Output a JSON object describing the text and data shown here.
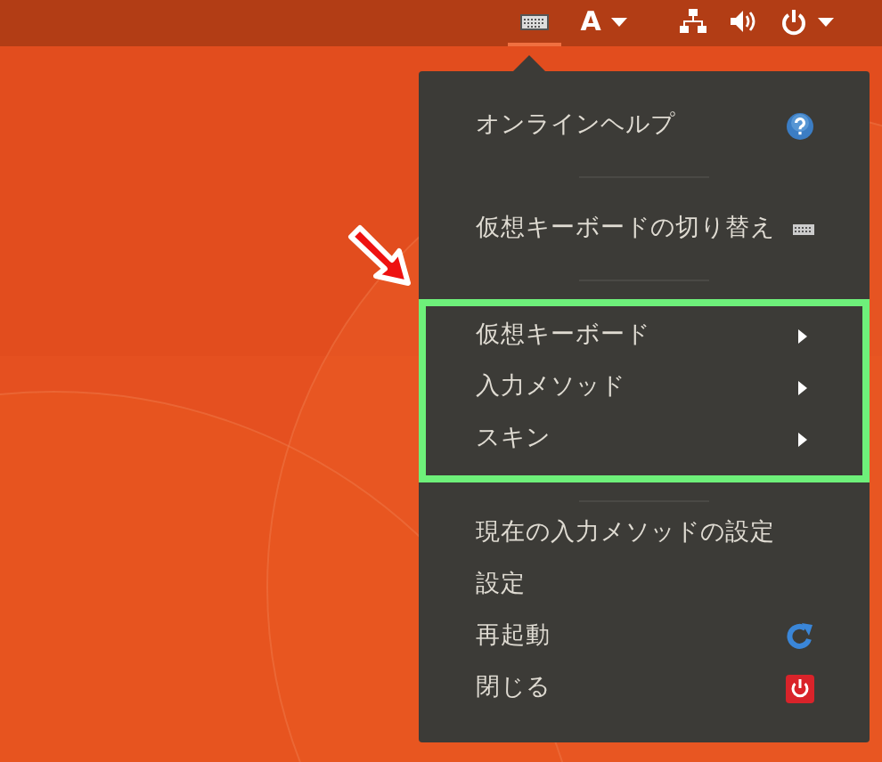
{
  "top_bar": {
    "indicators": [
      {
        "kind": "keyboard",
        "selected": true
      },
      {
        "kind": "input",
        "label": "A",
        "selected": false
      },
      {
        "kind": "network",
        "selected": false
      },
      {
        "kind": "volume",
        "selected": false
      },
      {
        "kind": "power",
        "selected": false
      }
    ]
  },
  "menu": {
    "sections": [
      {
        "highlighted": false,
        "items": [
          {
            "label": "オンラインヘルプ",
            "kind": "help"
          }
        ]
      },
      {
        "highlighted": false,
        "items": [
          {
            "label": "仮想キーボードの切り替え",
            "kind": "keyboard"
          }
        ]
      },
      {
        "highlighted": true,
        "items": [
          {
            "label": "仮想キーボード",
            "kind": "submenu"
          },
          {
            "label": "入力メソッド",
            "kind": "submenu"
          },
          {
            "label": "スキン",
            "kind": "submenu"
          }
        ]
      },
      {
        "highlighted": false,
        "items": [
          {
            "label": "現在の入力メソッドの設定",
            "kind": "plain"
          },
          {
            "label": "設定",
            "kind": "plain"
          },
          {
            "label": "再起動",
            "kind": "restart"
          },
          {
            "label": "閉じる",
            "kind": "quit"
          }
        ]
      }
    ]
  }
}
